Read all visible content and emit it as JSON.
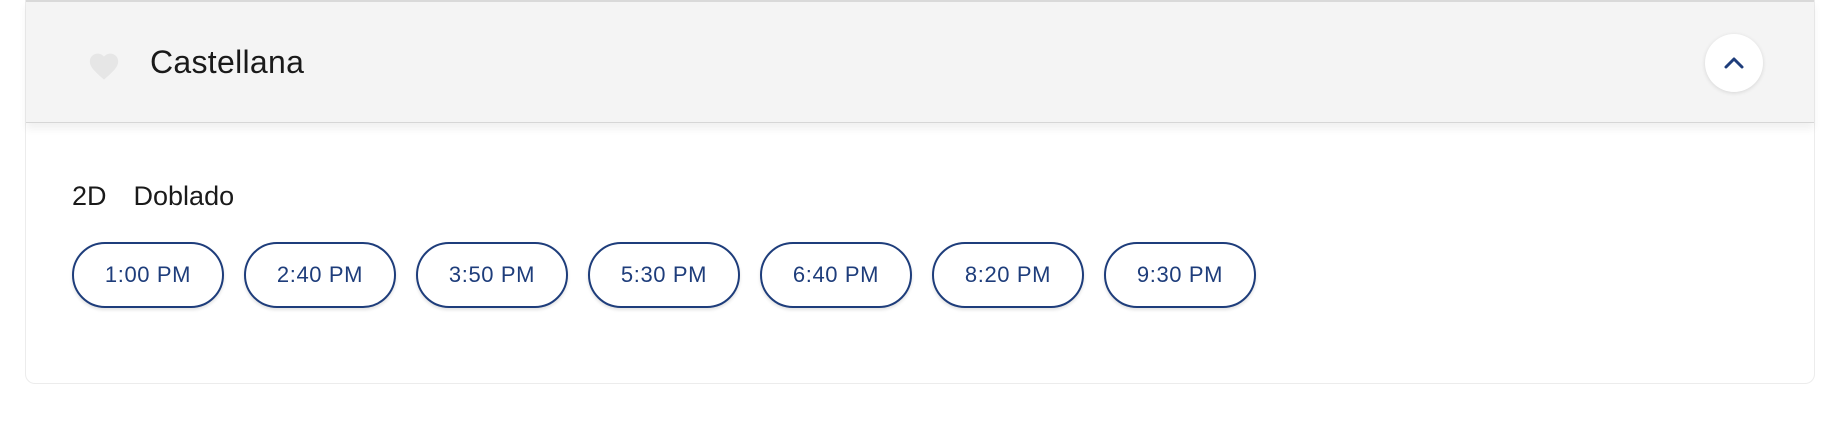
{
  "theater": {
    "name": "Castellana",
    "favorite_icon": "heart-icon",
    "collapse_icon": "chevron-up-icon"
  },
  "format": {
    "label": "2D  Doblado"
  },
  "showtimes": [
    "1:00 PM",
    "2:40 PM",
    "3:50 PM",
    "5:30 PM",
    "6:40 PM",
    "8:20 PM",
    "9:30 PM"
  ],
  "colors": {
    "accent": "#1e3d7b",
    "header_bg": "#f4f4f4",
    "heart": "#e6e6e6"
  }
}
